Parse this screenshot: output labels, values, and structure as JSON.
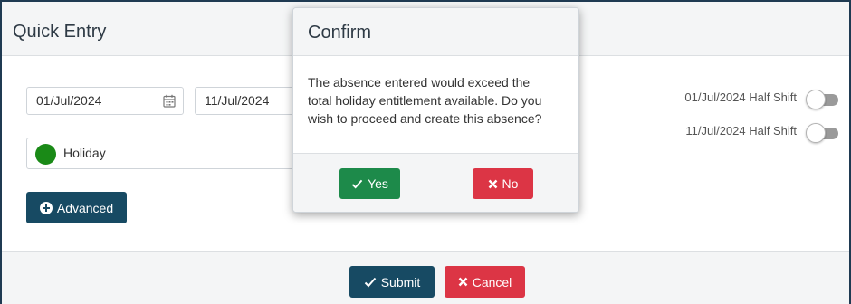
{
  "panel": {
    "title": "Quick Entry",
    "start_date": "01/Jul/2024",
    "end_date": "11/Jul/2024",
    "absence_type": "Holiday",
    "absence_type_color": "#1a8a17",
    "advanced_label": "Advanced",
    "half_shift_start_label": "01/Jul/2024 Half Shift",
    "half_shift_end_label": "11/Jul/2024 Half Shift",
    "submit_label": "Submit",
    "cancel_label": "Cancel"
  },
  "modal": {
    "title": "Confirm",
    "message_line1": "The absence entered would exceed the",
    "message_line2": "total holiday entitlement available. Do you",
    "message_line3": "wish to proceed and create this absence?",
    "yes_label": "Yes",
    "no_label": "No"
  },
  "icons": {
    "calendar": "calendar-icon",
    "check": "check-icon",
    "times": "times-icon",
    "plus_circle": "plus-circle-icon"
  },
  "colors": {
    "primary_dark": "#174a63",
    "success": "#1d8a4a",
    "danger": "#dc3545",
    "border_dark": "#1f3a52"
  }
}
